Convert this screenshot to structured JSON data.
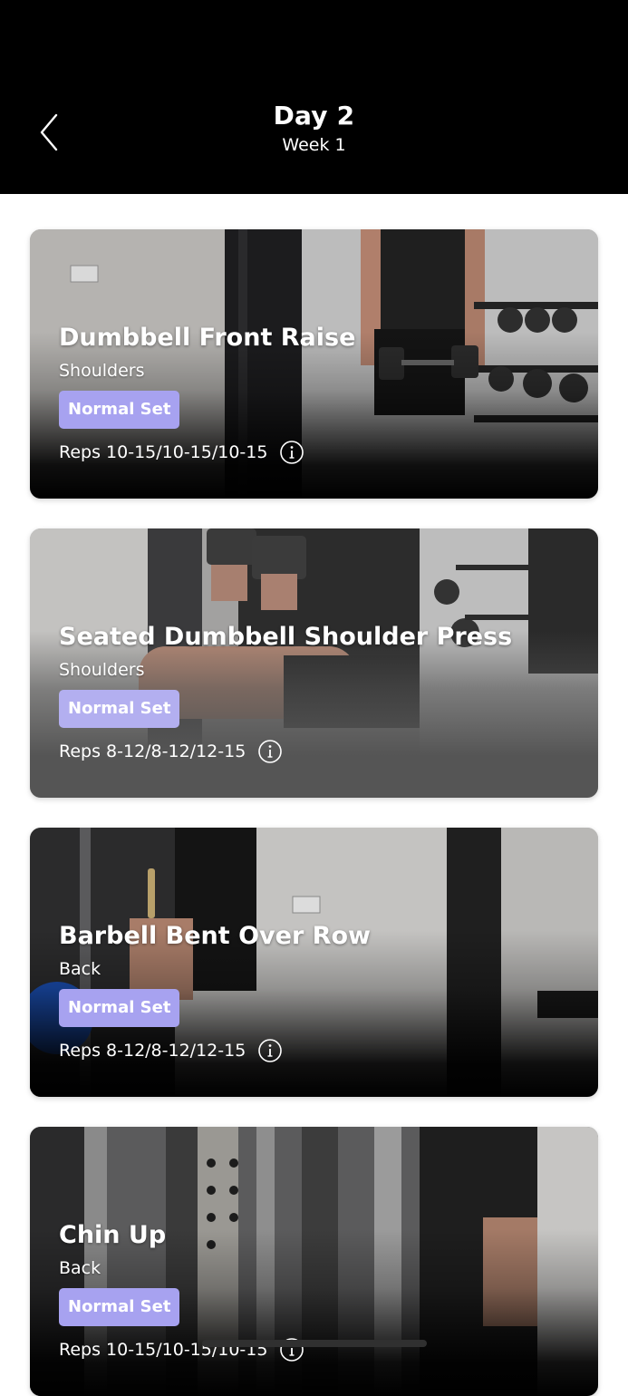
{
  "header": {
    "title": "Day 2",
    "subtitle": "Week 1",
    "back_icon": "chevron-left-icon"
  },
  "colors": {
    "header_bg": "#000000",
    "badge_bg": "#A7A2F0",
    "badge_bg_dim": "#B3AFF0"
  },
  "exercises": [
    {
      "name": "Dumbbell Front Raise",
      "muscle": "Shoulders",
      "set_type": "Normal Set",
      "reps": "Reps 10-15/10-15/10-15",
      "info_icon": "info-icon"
    },
    {
      "name": "Seated Dumbbell Shoulder Press",
      "muscle": "Shoulders",
      "set_type": "Normal Set",
      "reps": "Reps 8-12/8-12/12-15",
      "info_icon": "info-icon"
    },
    {
      "name": "Barbell Bent Over Row",
      "muscle": "Back",
      "set_type": "Normal Set",
      "reps": "Reps 8-12/8-12/12-15",
      "info_icon": "info-icon"
    },
    {
      "name": "Chin Up",
      "muscle": "Back",
      "set_type": "Normal Set",
      "reps": "Reps 10-15/10-15/10-15",
      "info_icon": "info-icon"
    }
  ]
}
